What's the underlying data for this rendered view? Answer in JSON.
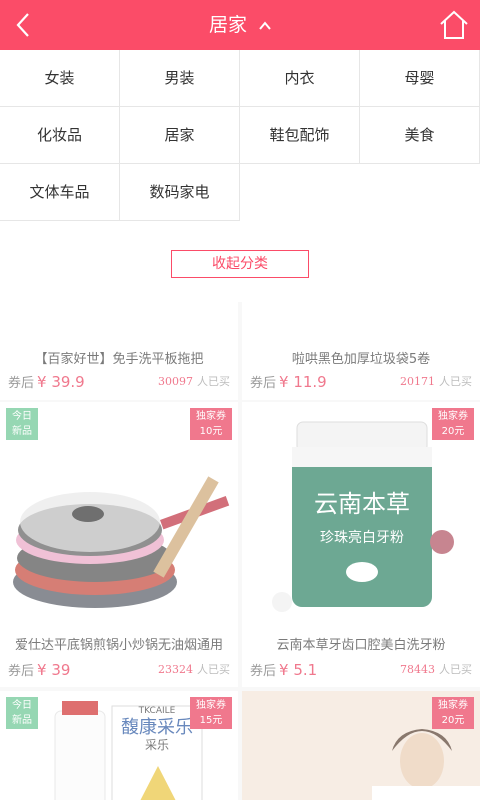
{
  "header": {
    "title": "居家",
    "back_icon": "back-arrow-icon",
    "title_icon": "chevron-up-icon",
    "home_icon": "home-icon",
    "bg_color": "#fb4c68"
  },
  "categories": [
    "女装",
    "男装",
    "内衣",
    "母婴",
    "化妆品",
    "居家",
    "鞋包配饰",
    "美食",
    "文体车品",
    "数码家电"
  ],
  "collapse_label": "收起分类",
  "products": [
    {
      "name": "【百家好世】免手洗平板拖把",
      "price_label": "券后",
      "price": "¥ 39.9",
      "sold_count": "30097",
      "sold_label": "人已买"
    },
    {
      "name": "啦哄黑色加厚垃圾袋5卷",
      "price_label": "券后",
      "price": "¥ 11.9",
      "sold_count": "20171",
      "sold_label": "人已买"
    },
    {
      "name": "爱仕达平底锅煎锅小炒锅无油烟通用",
      "price_label": "券后",
      "price": "¥ 39",
      "sold_count": "23324",
      "sold_label": "人已买",
      "badge_today": [
        "今日",
        "新品"
      ],
      "badge_coupon": [
        "独家券",
        "10元"
      ]
    },
    {
      "name": "云南本草牙齿口腔美白洗牙粉",
      "price_label": "券后",
      "price": "¥ 5.1",
      "sold_count": "78443",
      "sold_label": "人已买",
      "badge_coupon": [
        "独家券",
        "20元"
      ],
      "image_text": [
        "云南本草",
        "珍珠亮白牙粉"
      ]
    },
    {
      "badge_today": [
        "今日",
        "新品"
      ],
      "badge_coupon": [
        "独家券",
        "15元"
      ],
      "image_text": [
        "TKCAILE",
        "馥康采乐",
        "采乐"
      ]
    },
    {
      "badge_coupon": [
        "独家券",
        "20元"
      ]
    }
  ]
}
